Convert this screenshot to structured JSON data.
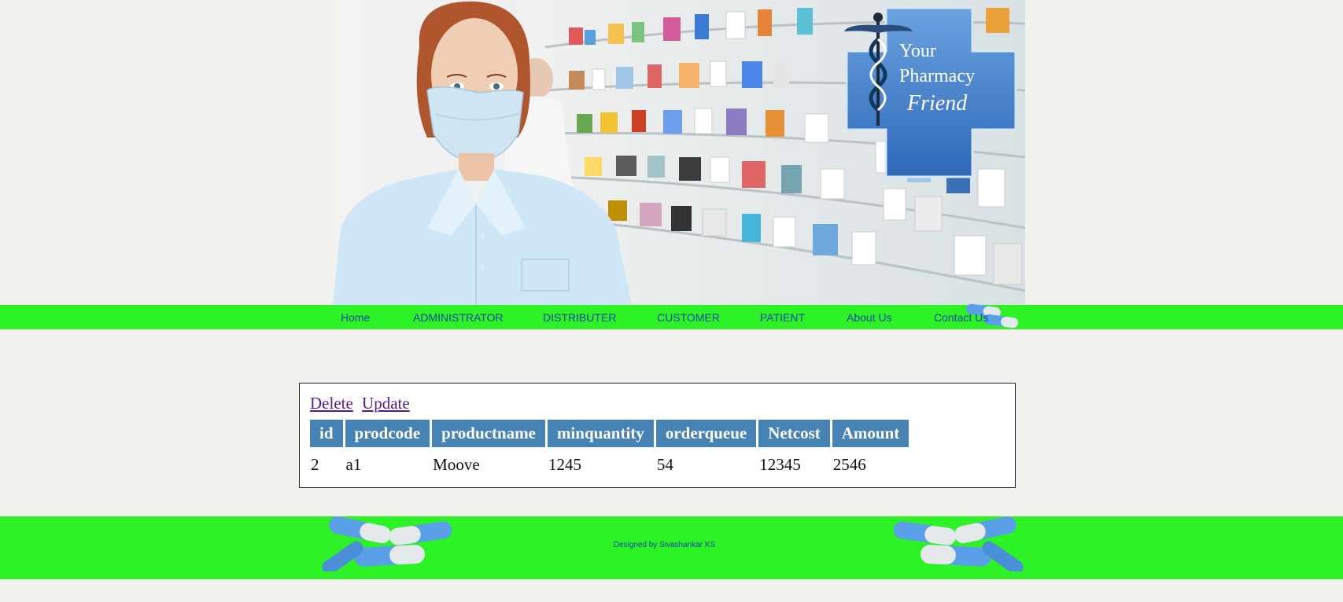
{
  "banner": {
    "logo_lines": [
      "Your",
      "Pharmacy",
      "Friend"
    ],
    "image_description_icon": "pharmacist-photo"
  },
  "nav": {
    "items": [
      {
        "label": "Home"
      },
      {
        "label": "ADMINISTRATOR"
      },
      {
        "label": "DISTRIBUTER"
      },
      {
        "label": "CUSTOMER"
      },
      {
        "label": "PATIENT"
      },
      {
        "label": "About Us"
      },
      {
        "label": "Contact Us"
      }
    ]
  },
  "actions": {
    "delete_label": "Delete",
    "update_label": "Update"
  },
  "table": {
    "headers": [
      "id",
      "prodcode",
      "productname",
      "minquantity",
      "orderqueue",
      "Netcost",
      "Amount"
    ],
    "rows": [
      [
        "2",
        "a1",
        "Moove",
        "1245",
        "54",
        "12345",
        "2546"
      ]
    ]
  },
  "footer": {
    "credit": "Designed by Sivashankar KS"
  },
  "colors": {
    "nav_green": "#2df225",
    "nav_text": "#1c46a8",
    "header_blue": "#4682b4",
    "link_purple": "#551a8b"
  }
}
